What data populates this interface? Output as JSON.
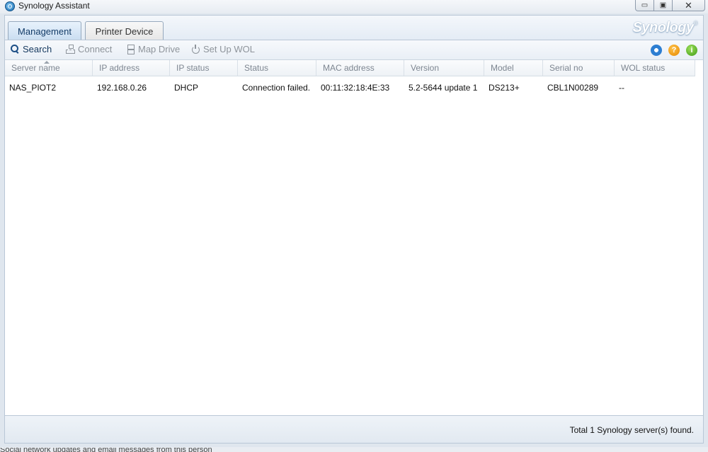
{
  "window": {
    "title": "Synology Assistant",
    "controls": {
      "minimize": "▭",
      "maximize": "▣",
      "close": "✕"
    }
  },
  "tabs": [
    {
      "label": "Management",
      "active": true
    },
    {
      "label": "Printer Device",
      "active": false
    }
  ],
  "brand": {
    "name": "Synology",
    "mark": "®"
  },
  "toolbar": {
    "search": {
      "label": "Search",
      "icon": "search-icon",
      "enabled": true
    },
    "connect": {
      "label": "Connect",
      "icon": "network-icon",
      "enabled": false
    },
    "map_drive": {
      "label": "Map Drive",
      "icon": "drive-icon",
      "enabled": false
    },
    "set_up_wol": {
      "label": "Set Up WOL",
      "icon": "power-icon",
      "enabled": false
    },
    "right_icons": [
      "gear-icon",
      "help-icon",
      "info-icon"
    ]
  },
  "grid": {
    "columns": [
      "Server name",
      "IP address",
      "IP status",
      "Status",
      "MAC address",
      "Version",
      "Model",
      "Serial no",
      "WOL status"
    ],
    "rows": [
      [
        "NAS_PIOT2",
        "192.168.0.26",
        "DHCP",
        "Connection failed.",
        "00:11:32:18:4E:33",
        "5.2-5644 update 1",
        "DS213+",
        "CBL1N00289",
        "--"
      ]
    ]
  },
  "status_bar": {
    "text": "Total 1 Synology server(s) found."
  },
  "background_text": "Social network updates and email messages from this person"
}
